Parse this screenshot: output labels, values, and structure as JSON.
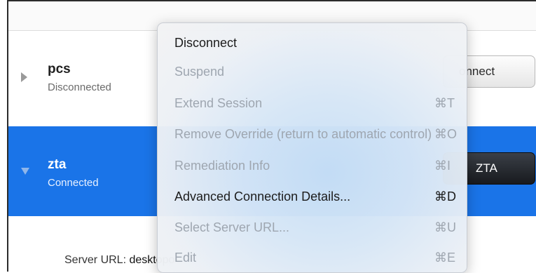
{
  "connections": [
    {
      "name": "pcs",
      "status": "Disconnected",
      "button": "onnect"
    },
    {
      "name": "zta",
      "status": "Connected",
      "button": "ZTA"
    }
  ],
  "details": {
    "server_url_label": "Server URL:",
    "server_url_value": "desktopo"
  },
  "menu": {
    "items": [
      {
        "label": "Disconnect",
        "shortcut": "",
        "enabled": true
      },
      {
        "label": "Suspend",
        "shortcut": "",
        "enabled": false
      },
      {
        "label": "Extend Session",
        "shortcut": "⌘T",
        "enabled": false
      },
      {
        "label": "Remove Override (return to automatic control)",
        "shortcut": "⌘O",
        "enabled": false
      },
      {
        "label": "Remediation Info",
        "shortcut": "⌘I",
        "enabled": false
      },
      {
        "label": "Advanced Connection Details...",
        "shortcut": "⌘D",
        "enabled": true
      },
      {
        "label": "Select Server URL...",
        "shortcut": "⌘U",
        "enabled": false
      },
      {
        "label": "Edit",
        "shortcut": "⌘E",
        "enabled": false
      }
    ]
  },
  "colors": {
    "selection": "#1a74e8"
  }
}
